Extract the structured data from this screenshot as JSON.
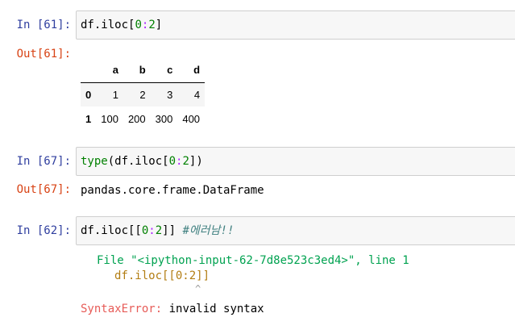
{
  "cells": [
    {
      "in_prompt": "In [61]:",
      "code": [
        {
          "text": "df.iloc[",
          "cls": ""
        },
        {
          "text": "0",
          "cls": "cm-number"
        },
        {
          "text": ":",
          "cls": "cm-op"
        },
        {
          "text": "2",
          "cls": "cm-number"
        },
        {
          "text": "]",
          "cls": ""
        }
      ],
      "out_prompt": "Out[61]:",
      "table": {
        "columns": [
          "",
          "a",
          "b",
          "c",
          "d"
        ],
        "rows": [
          {
            "index": "0",
            "values": [
              "1",
              "2",
              "3",
              "4"
            ]
          },
          {
            "index": "1",
            "values": [
              "100",
              "200",
              "300",
              "400"
            ]
          }
        ]
      }
    },
    {
      "in_prompt": "In [67]:",
      "code": [
        {
          "text": "type",
          "cls": "cm-builtin"
        },
        {
          "text": "(df.iloc[",
          "cls": ""
        },
        {
          "text": "0",
          "cls": "cm-number"
        },
        {
          "text": ":",
          "cls": "cm-op"
        },
        {
          "text": "2",
          "cls": "cm-number"
        },
        {
          "text": "])",
          "cls": ""
        }
      ],
      "out_prompt": "Out[67]:",
      "output_text": "pandas.core.frame.DataFrame"
    },
    {
      "in_prompt": "In [62]:",
      "code": [
        {
          "text": "df.iloc[[",
          "cls": ""
        },
        {
          "text": "0",
          "cls": "cm-number"
        },
        {
          "text": ":",
          "cls": "cm-op"
        },
        {
          "text": "2",
          "cls": "cm-number"
        },
        {
          "text": "]] ",
          "cls": ""
        },
        {
          "text": "#에러남!!",
          "cls": "cm-comment"
        }
      ],
      "traceback": {
        "file_line": "File \"<ipython-input-62-7d8e523c3ed4>\", line 1",
        "code_line": "df.iloc[[0:2]]",
        "caret": "^",
        "error_name": "SyntaxError:",
        "error_message": " invalid syntax"
      }
    }
  ]
}
